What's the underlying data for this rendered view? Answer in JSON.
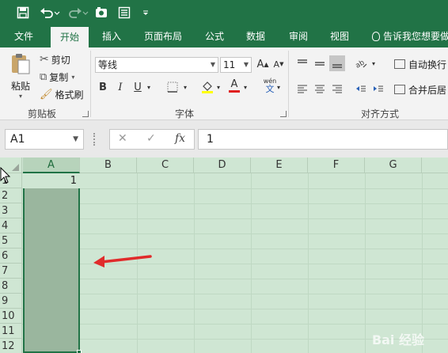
{
  "colors": {
    "brand": "#217346",
    "arrow": "#e02b2b",
    "selection": "#9ab69e"
  },
  "qat": {
    "save_icon": "save-icon",
    "undo_icon": "undo-icon",
    "redo_icon": "redo-icon",
    "touch_icon": "touch-mode-icon",
    "form_icon": "form-icon",
    "customize_icon": "customize-qat-icon"
  },
  "tabs": [
    "文件",
    "开始",
    "插入",
    "页面布局",
    "公式",
    "数据",
    "审阅",
    "视图"
  ],
  "active_tab": "开始",
  "tell_me": "告诉我您想要做",
  "clipboard": {
    "paste": "粘贴",
    "cut": "剪切",
    "copy": "复制",
    "format_painter": "格式刷",
    "label": "剪贴板"
  },
  "font": {
    "name": "等线",
    "size": "11",
    "bold": "B",
    "italic": "I",
    "underline": "U",
    "color_letter": "A",
    "pinyin": "wén",
    "label": "字体"
  },
  "alignment": {
    "wrap": "自动换行",
    "merge": "合并后居",
    "label": "对齐方式"
  },
  "formula_bar": {
    "name_box": "A1",
    "cancel": "✕",
    "enter": "✓",
    "fx": "fx",
    "value": "1"
  },
  "grid": {
    "columns": [
      "A",
      "B",
      "C",
      "D",
      "E",
      "F",
      "G"
    ],
    "rows": [
      "1",
      "2",
      "3",
      "4",
      "5",
      "6",
      "7",
      "8",
      "9",
      "10",
      "11",
      "12"
    ],
    "selected_column": "A",
    "cell_a1": "1"
  },
  "watermark": "Bai 经验"
}
